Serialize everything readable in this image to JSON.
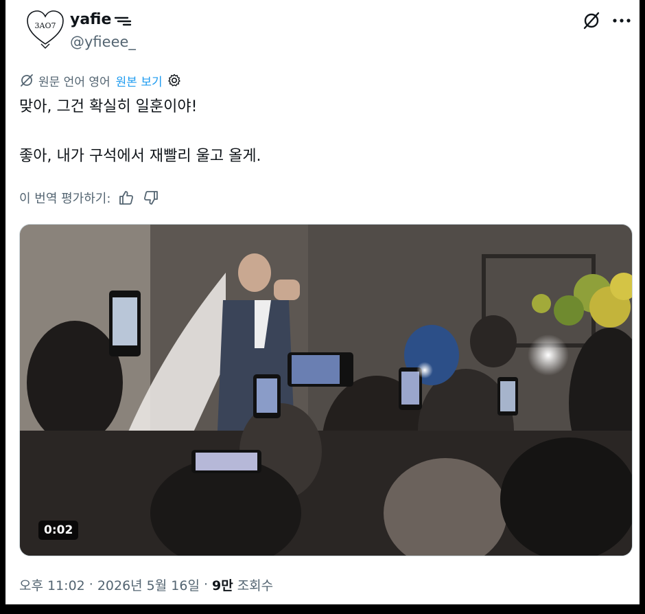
{
  "author": {
    "display_name": "yafie",
    "handle": "@yfieee_",
    "avatar_text": "3AO7"
  },
  "translation": {
    "source_language": "원문 언어 영어",
    "show_original": "원본 보기"
  },
  "tweet": {
    "line1": "맞아, 그건 확실히 일훈이야!",
    "line2": "좋아, 내가 구석에서 재빨리 울고 올게."
  },
  "rating": {
    "label": "이 번역 평가하기:"
  },
  "media": {
    "duration": "0:02"
  },
  "meta": {
    "time": "오후 11:02",
    "separator1": "·",
    "date": "2026년 5월 16일",
    "separator2": "·",
    "views_count": "9만",
    "views_label": "조회수"
  },
  "colors": {
    "text_primary": "#0f1419",
    "text_secondary": "#536471",
    "link": "#1d9bf0"
  },
  "icons": {
    "grok": "slashed-circle-icon",
    "more": "more-horizontal-icon",
    "translate": "slashed-circle-icon",
    "settings": "gear-icon",
    "thumbs_up": "thumbs-up-icon",
    "thumbs_down": "thumbs-down-icon"
  }
}
